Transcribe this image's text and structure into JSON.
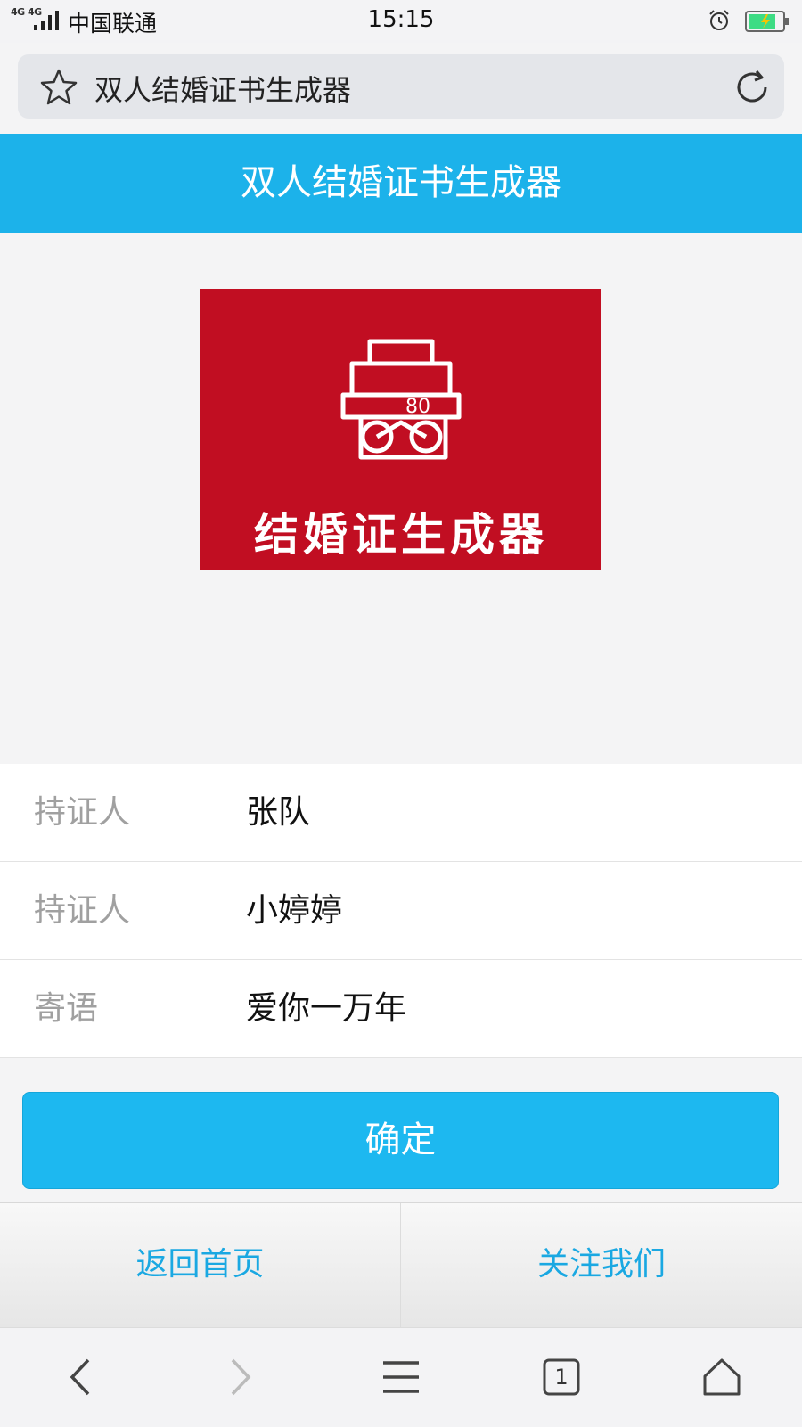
{
  "status_bar": {
    "network": "4G 4G",
    "carrier": "中国联通",
    "time": "15:15"
  },
  "browser": {
    "address_title": "双人结婚证书生成器",
    "tab_count": "1",
    "icons": [
      "star-icon",
      "refresh-icon",
      "back-icon",
      "forward-icon",
      "menu-icon",
      "tabs-icon",
      "home-icon"
    ]
  },
  "header": {
    "title": "双人结婚证书生成器"
  },
  "banner": {
    "text": "结婚证生成器",
    "background_color": "#c10e22"
  },
  "form": {
    "rows": [
      {
        "label": "持证人",
        "value": "张队"
      },
      {
        "label": "持证人",
        "value": "小婷婷"
      },
      {
        "label": "寄语",
        "value": "爱你一万年"
      }
    ]
  },
  "confirm_label": "确定",
  "links": {
    "home": "返回首页",
    "follow": "关注我们"
  },
  "colors": {
    "accent": "#1cb2ea",
    "link": "#1aa8e2",
    "battery": "#3ddc84"
  }
}
